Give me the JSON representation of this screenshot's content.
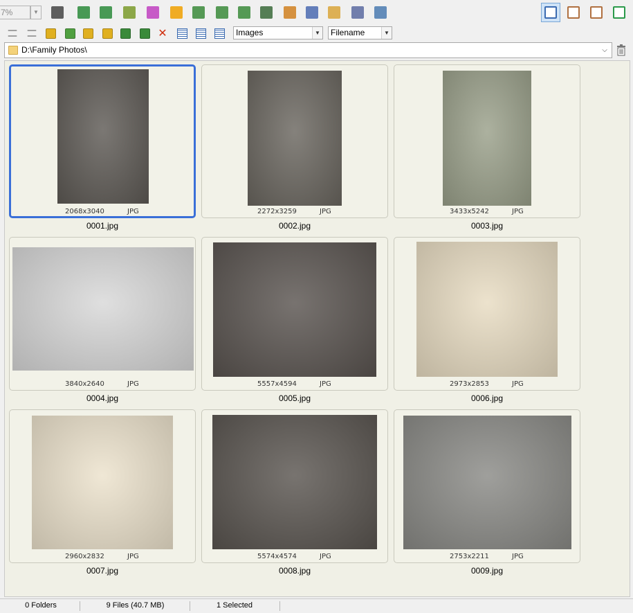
{
  "toolbar": {
    "zoom_value": "7%",
    "view_mode_options": "Images",
    "sort_by": "Filename",
    "buttons": [
      {
        "name": "hand-tool-icon",
        "color": "#444444"
      },
      {
        "name": "slideshow-icon",
        "color": "#2a8a3a"
      },
      {
        "name": "resize-icon",
        "color": "#2a8a3a"
      },
      {
        "name": "crop-icon",
        "color": "#7a9a2a"
      },
      {
        "name": "color-icon",
        "color": "#c040c0"
      },
      {
        "name": "brightness-icon",
        "color": "#f0a000"
      },
      {
        "name": "stamp-icon",
        "color": "#3a8a3a"
      },
      {
        "name": "rotate-left-icon",
        "color": "#3a8a3a"
      },
      {
        "name": "rotate-right-icon",
        "color": "#3a8a3a"
      },
      {
        "name": "compare-icon",
        "color": "#3a6a3a"
      },
      {
        "name": "screen-icon",
        "color": "#d08020"
      },
      {
        "name": "scan-icon",
        "color": "#4a6ab0"
      },
      {
        "name": "email-icon",
        "color": "#d9a43a"
      },
      {
        "name": "print-icon",
        "color": "#5a6aa0"
      },
      {
        "name": "options-icon",
        "color": "#4a7ab0"
      }
    ],
    "right_buttons": [
      {
        "name": "thumbnails-view-icon",
        "color": "#3a6ab0"
      },
      {
        "name": "preview-view-icon",
        "color": "#b07040"
      },
      {
        "name": "fullscreen-view-icon",
        "color": "#b07040"
      },
      {
        "name": "maximize-icon",
        "color": "#2a9a4a"
      }
    ]
  },
  "toolbar2_buttons": [
    {
      "name": "back-icon",
      "color": "#a0a0a0"
    },
    {
      "name": "forward-icon",
      "color": "#a0a0a0"
    },
    {
      "name": "parent-folder-icon",
      "color": "#e0b020"
    },
    {
      "name": "refresh-folder-icon",
      "color": "#50a040"
    },
    {
      "name": "favorite-folder-icon",
      "color": "#e0b020"
    },
    {
      "name": "new-folder-icon",
      "color": "#e0b020"
    },
    {
      "name": "copy-to-folder-icon",
      "color": "#3a8a3a"
    },
    {
      "name": "move-to-folder-icon",
      "color": "#3a8a3a"
    },
    {
      "name": "delete-icon",
      "color": "#d03010"
    },
    {
      "name": "thumbnails-icon",
      "color": "#3a6ab0"
    },
    {
      "name": "details-icon",
      "color": "#3a6ab0"
    },
    {
      "name": "list-icon",
      "color": "#3a6ab0"
    }
  ],
  "address": {
    "path": "D:\\Family Photos\\"
  },
  "files": [
    {
      "name": "0001.jpg",
      "dims": "2068x3040",
      "type": "JPG",
      "selected": true,
      "tone": "#5e5a55"
    },
    {
      "name": "0002.jpg",
      "dims": "2272x3259",
      "type": "JPG",
      "selected": false,
      "tone": "#6a665f"
    },
    {
      "name": "0003.jpg",
      "dims": "3433x5242",
      "type": "JPG",
      "selected": false,
      "tone": "#9aa08a"
    },
    {
      "name": "0004.jpg",
      "dims": "3840x2640",
      "type": "JPG",
      "selected": false,
      "tone": "#d8d8d8"
    },
    {
      "name": "0005.jpg",
      "dims": "5557x4594",
      "type": "JPG",
      "selected": false,
      "tone": "#5a5450"
    },
    {
      "name": "0006.jpg",
      "dims": "2973x2853",
      "type": "JPG",
      "selected": false,
      "tone": "#e8dcc2"
    },
    {
      "name": "0007.jpg",
      "dims": "2960x2832",
      "type": "JPG",
      "selected": false,
      "tone": "#ece2cc"
    },
    {
      "name": "0008.jpg",
      "dims": "5574x4574",
      "type": "JPG",
      "selected": false,
      "tone": "#5a5550"
    },
    {
      "name": "0009.jpg",
      "dims": "2753x2211",
      "type": "JPG",
      "selected": false,
      "tone": "#8a8a86"
    }
  ],
  "status": {
    "folders": "0 Folders",
    "files": "9 Files (40.7 MB)",
    "selected": "1 Selected"
  }
}
